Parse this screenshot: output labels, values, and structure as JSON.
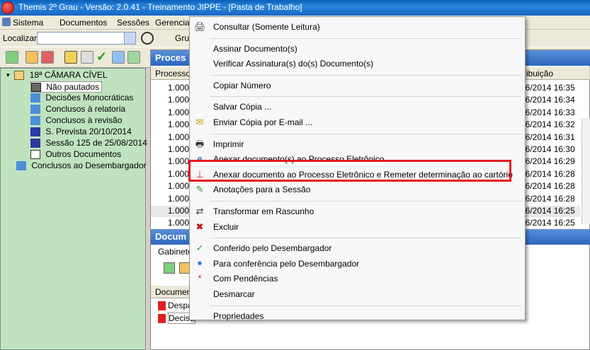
{
  "window": {
    "title": "Themis 2º Grau - Versão: 2.0.41 - Treinamento JIPPE - [Pasta de Trabalho]"
  },
  "menubar": {
    "items": [
      "Sistema",
      "Documentos",
      "Sessões",
      "Gerencia"
    ]
  },
  "search": {
    "label": "Localizar:",
    "group_label": "Grup"
  },
  "tree": {
    "root": "18ª CÂMARA CÍVEL",
    "children": [
      "Não pautados",
      "Decisões Monocráticas",
      "Conclusos à relatoria",
      "Conclusos à revisão",
      "S. Prevista 20/10/2014",
      "Sessão 125 de 25/08/2014",
      "Outros Documentos"
    ],
    "other": "Conclusos ao Desembargador"
  },
  "process_panel": {
    "title": "Proces",
    "col_process": "Processo",
    "col_dist": "ribuição",
    "rows": [
      {
        "proc": "1.000",
        "date": "06/2014 16:35"
      },
      {
        "proc": "1.000",
        "date": "06/2014 16:34"
      },
      {
        "proc": "1.000",
        "date": "06/2014 16:33"
      },
      {
        "proc": "1.000",
        "date": "06/2014 16:32"
      },
      {
        "proc": "1.000",
        "date": "06/2014 16:31"
      },
      {
        "proc": "1.000",
        "date": "06/2014 16:30"
      },
      {
        "proc": "1.000",
        "date": "06/2014 16:29"
      },
      {
        "proc": "1.000",
        "date": "06/2014 16:28"
      },
      {
        "proc": "1.000",
        "date": "06/2014 16:28"
      },
      {
        "proc": "1.000",
        "date": "06/2014 16:28"
      },
      {
        "proc": "1.000",
        "date": "06/2014 16:25"
      },
      {
        "proc": "1.000",
        "date": "06/2014 16:25"
      }
    ]
  },
  "doc_panel": {
    "title": "Docum",
    "tab": "Gabinete",
    "col_doc": "Documen",
    "rows": [
      "Despa",
      "Decisã"
    ]
  },
  "context_menu": {
    "items": [
      {
        "label": "Consultar (Somente Leitura)",
        "icon": "print-preview-icon"
      },
      {
        "sep": true
      },
      {
        "label": "Assinar Documento(s)",
        "icon": ""
      },
      {
        "label": "Verificar Assinatura(s) do(s) Documento(s)",
        "icon": ""
      },
      {
        "sep": true
      },
      {
        "label": "Copiar Número",
        "icon": ""
      },
      {
        "sep": true
      },
      {
        "label": "Salvar Cópia ...",
        "icon": ""
      },
      {
        "label": "Enviar Cópia por E-mail ...",
        "icon": "envelope-icon"
      },
      {
        "sep": true
      },
      {
        "label": "Imprimir",
        "icon": "printer-icon"
      },
      {
        "label": "Anexar documento(s) ao Processo Eletrônico",
        "icon": "attach-e-icon"
      },
      {
        "label": "Anexar documento ao Processo Eletrônico e Remeter determinação ao cartório",
        "icon": "stamp-icon"
      },
      {
        "label": "Anotações para a Sessão",
        "icon": "pencil-note-icon"
      },
      {
        "sep": true
      },
      {
        "label": "Transformar em Rascunho",
        "icon": "transform-icon"
      },
      {
        "label": "Excluir",
        "icon": "delete-icon"
      },
      {
        "sep": true
      },
      {
        "label": "Conferido pelo Desembargador",
        "icon": "checkmark-icon"
      },
      {
        "label": "Para conferência pelo Desembargador",
        "icon": "blue-dot-icon"
      },
      {
        "label": "Com Pendências",
        "icon": "red-asterisk-icon"
      },
      {
        "label": "Desmarcar",
        "icon": ""
      },
      {
        "sep": true
      },
      {
        "label": "Propriedades",
        "icon": ""
      }
    ]
  },
  "colors": {
    "highlight_border": "#e11b22",
    "tree_bg": "#bfe3bf",
    "panel_header": "#2e66c0"
  }
}
